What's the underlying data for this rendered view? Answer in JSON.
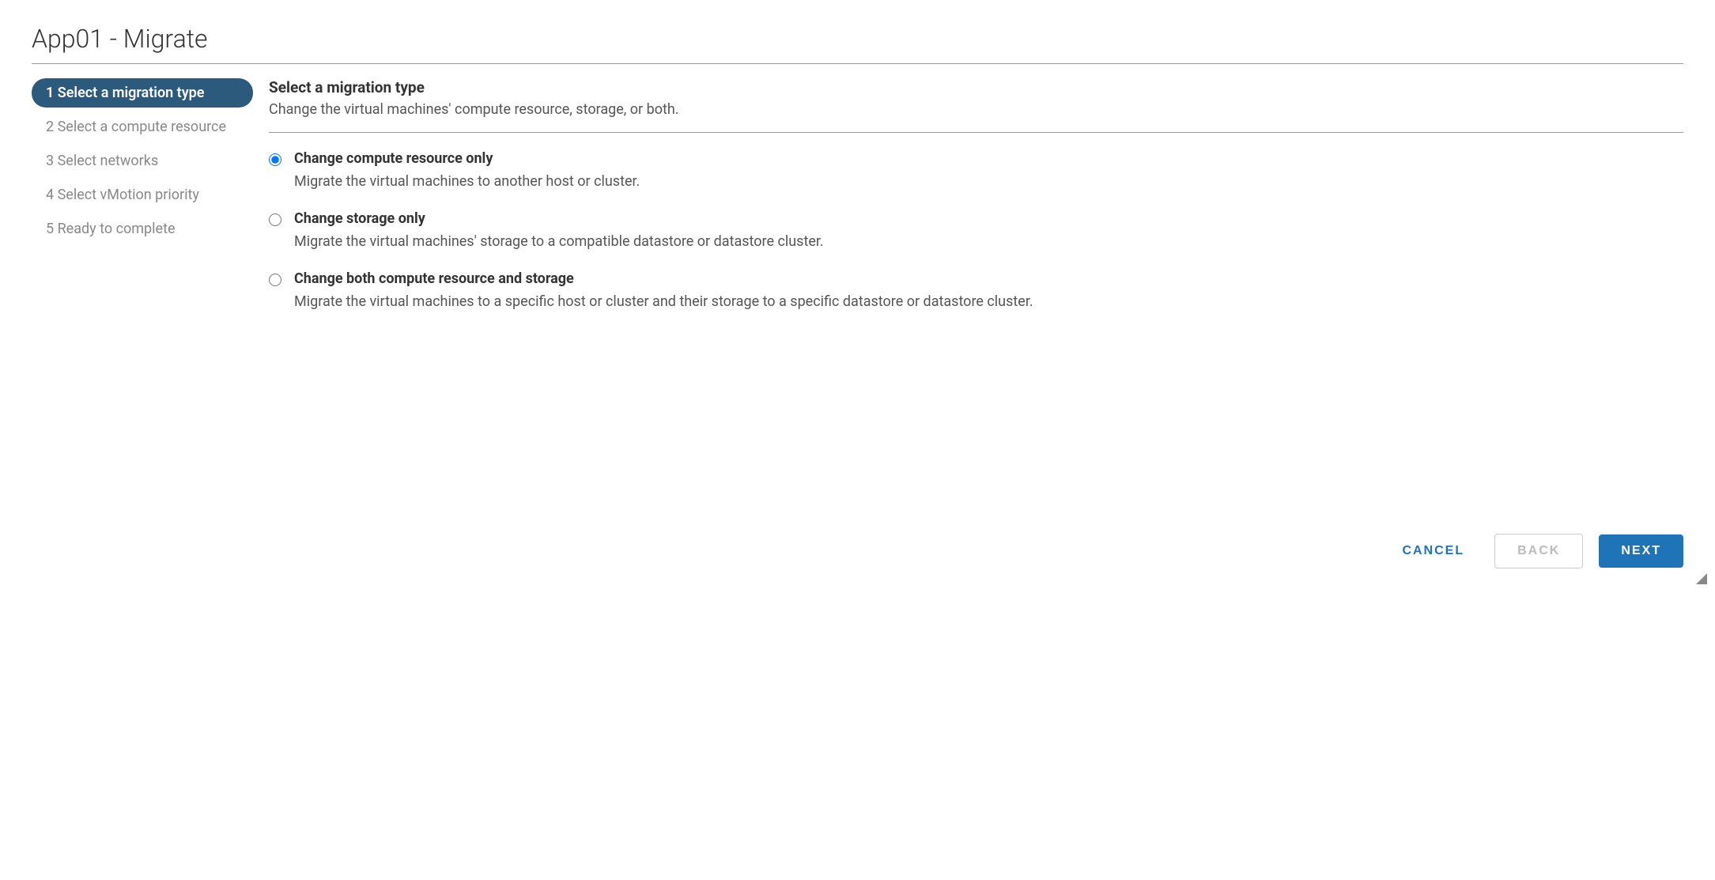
{
  "dialog": {
    "title": "App01 - Migrate"
  },
  "wizard": {
    "steps": [
      {
        "label": "1 Select a migration type",
        "active": true
      },
      {
        "label": "2 Select a compute resource",
        "active": false
      },
      {
        "label": "3 Select networks",
        "active": false
      },
      {
        "label": "4 Select vMotion priority",
        "active": false
      },
      {
        "label": "5 Ready to complete",
        "active": false
      }
    ]
  },
  "panel": {
    "title": "Select a migration type",
    "subtitle": "Change the virtual machines' compute resource, storage, or both."
  },
  "options": [
    {
      "label": "Change compute resource only",
      "desc": "Migrate the virtual machines to another host or cluster.",
      "selected": true
    },
    {
      "label": "Change storage only",
      "desc": "Migrate the virtual machines' storage to a compatible datastore or datastore cluster.",
      "selected": false
    },
    {
      "label": "Change both compute resource and storage",
      "desc": "Migrate the virtual machines to a specific host or cluster and their storage to a specific datastore or datastore cluster.",
      "selected": false
    }
  ],
  "footer": {
    "cancel": "CANCEL",
    "back": "BACK",
    "next": "NEXT"
  }
}
